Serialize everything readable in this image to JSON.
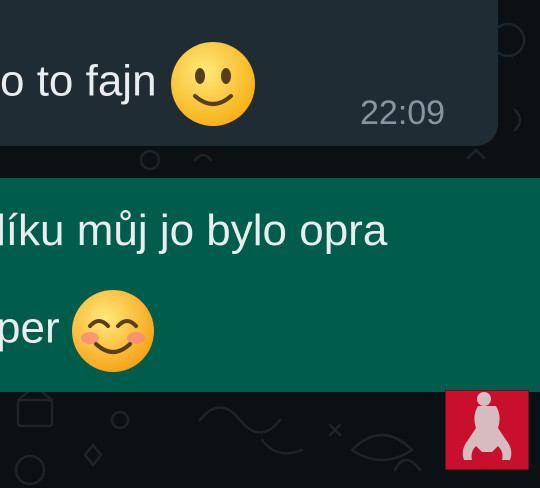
{
  "incoming_message": {
    "text": "o to fajn",
    "emoji": "slightly-smiling-face-emoji",
    "time": "22:09"
  },
  "outgoing_message": {
    "line1": "líku můj jo bylo opra",
    "line2": "per",
    "emoji": "smiling-face-with-smiling-eyes-emoji"
  },
  "colors": {
    "background": "#0b1014",
    "incoming_bubble": "#1f2c33",
    "outgoing_bubble": "#005c4b",
    "text": "#e9edef",
    "timestamp": "#8696a0",
    "badge": "#c8102e"
  },
  "badge": {
    "icon": "figure-silhouette-icon"
  }
}
